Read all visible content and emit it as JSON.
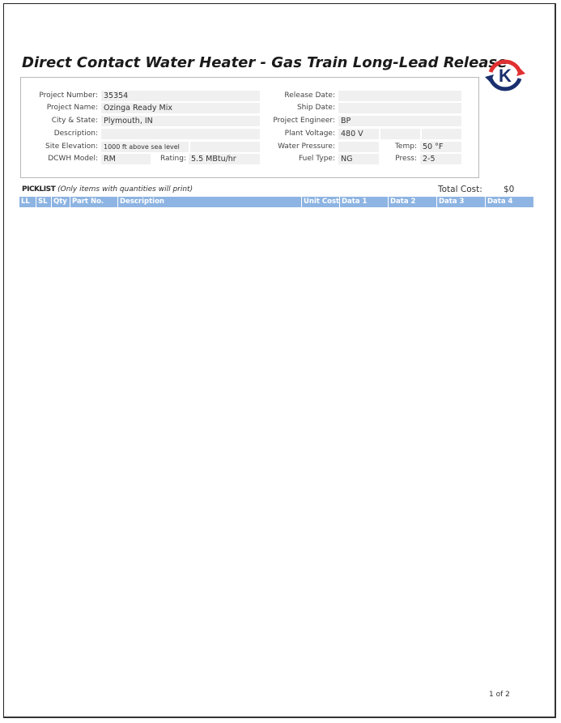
{
  "title": "Direct Contact Water Heater - Gas Train Long-Lead Release",
  "logo": {
    "letter": "K",
    "ring_color_red": "#e03030",
    "ring_color_blue": "#1a2f6e"
  },
  "left_fields": {
    "project_number": {
      "label": "Project Number:",
      "value": "35354"
    },
    "project_name": {
      "label": "Project Name:",
      "value": "Ozinga Ready Mix"
    },
    "city_state": {
      "label": "City & State:",
      "value": "Plymouth, IN"
    },
    "description": {
      "label": "Description:",
      "value": ""
    },
    "site_elevation": {
      "label": "Site Elevation:",
      "value": "1000 ft above sea level",
      "value2": ""
    },
    "dcwh_model": {
      "label": "DCWH Model:",
      "value": "RM"
    },
    "rating": {
      "label": "Rating:",
      "value": "5.5 MBtu/hr"
    }
  },
  "right_fields": {
    "release_date": {
      "label": "Release Date:",
      "value": ""
    },
    "ship_date": {
      "label": "Ship Date:",
      "value": ""
    },
    "project_engineer": {
      "label": "Project Engineer:",
      "value": "BP"
    },
    "plant_voltage": {
      "label": "Plant Voltage:",
      "value": "480 V",
      "value2": "",
      "value3": ""
    },
    "water_pressure": {
      "label": "Water Pressure:",
      "value": ""
    },
    "temp": {
      "label": "Temp:",
      "value": "50 °F"
    },
    "fuel_type": {
      "label": "Fuel Type:",
      "value": "NG"
    },
    "press": {
      "label": "Press:",
      "value": "2-5"
    }
  },
  "picklist": {
    "title": "PICKLIST",
    "note": "(Only items with quantities will print)",
    "total_label": "Total Cost:",
    "total_value": "$0"
  },
  "table": {
    "header_color": "#8db4e2",
    "columns": [
      "LL",
      "SL",
      "Qty",
      "Part No.",
      "Description",
      "Unit Cost",
      "Data 1",
      "Data 2",
      "Data 3",
      "Data 4"
    ]
  },
  "footer": {
    "page": "1 of 2"
  }
}
